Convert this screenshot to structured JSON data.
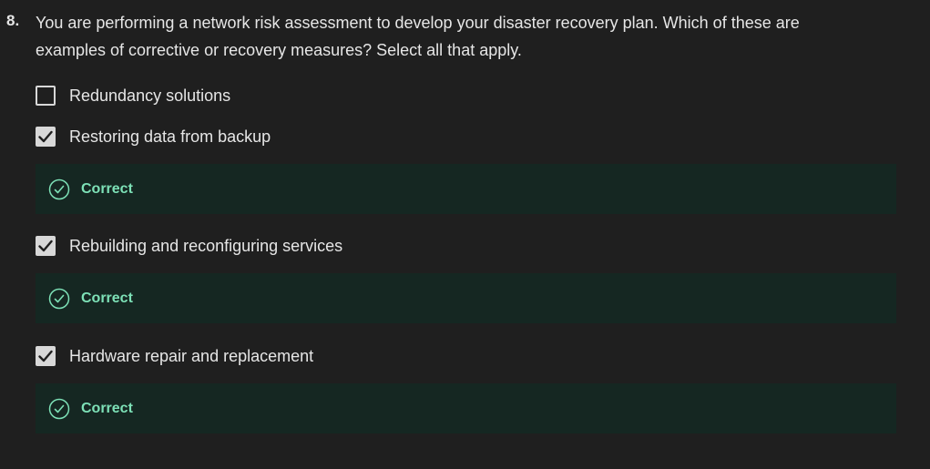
{
  "question": {
    "number": "8.",
    "text": "You are performing a network risk assessment to develop your disaster recovery plan. Which of these are examples of corrective or recovery measures? Select all that apply."
  },
  "options": [
    {
      "label": "Redundancy solutions",
      "checked": false
    },
    {
      "label": "Restoring data from backup",
      "checked": true,
      "feedback": "Correct"
    },
    {
      "label": "Rebuilding and reconfiguring services",
      "checked": true,
      "feedback": "Correct"
    },
    {
      "label": "Hardware repair and replacement",
      "checked": true,
      "feedback": "Correct"
    }
  ],
  "icons": {
    "checkbox_unchecked": "checkbox-empty-icon",
    "checkbox_checked": "checkmark-icon",
    "feedback": "check-circle-icon"
  },
  "colors": {
    "background": "#1f1f1f",
    "text": "#e6e6e6",
    "checkbox": "#d8d8d8",
    "feedback_background": "#152722",
    "feedback_text": "#7de1b7"
  }
}
